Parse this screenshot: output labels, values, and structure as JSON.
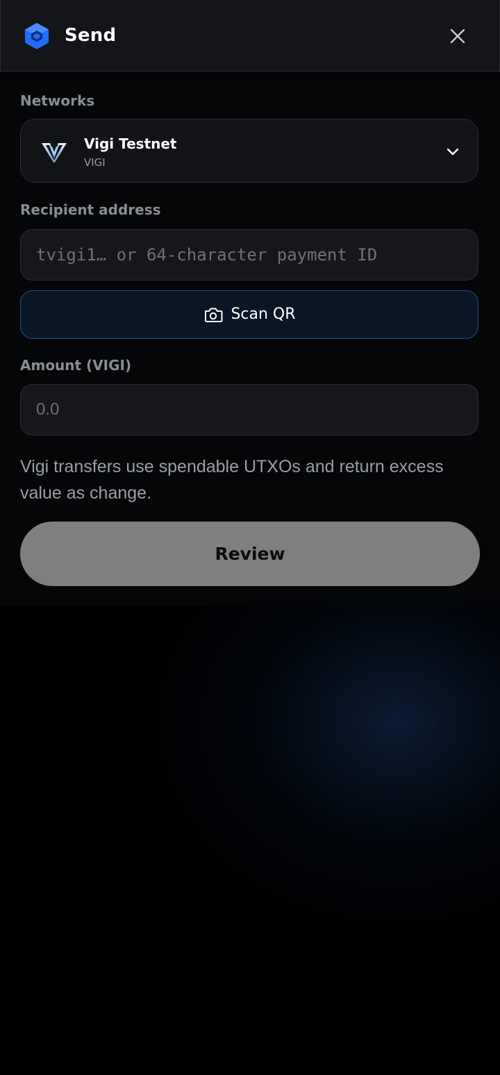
{
  "header": {
    "title": "Send",
    "logo_icon": "wallet-logo-icon",
    "close_icon": "close-icon"
  },
  "networks": {
    "label": "Networks",
    "selected_name": "Vigi Testnet",
    "selected_symbol": "VIGI",
    "network_icon": "vigi-logo-icon",
    "dropdown_icon": "chevron-down-icon"
  },
  "recipient": {
    "label": "Recipient address",
    "value": "",
    "placeholder": "tvigi1… or 64-character payment ID"
  },
  "scan": {
    "label": "Scan QR",
    "icon": "camera-icon"
  },
  "amount": {
    "label": "Amount (VIGI)",
    "value": "",
    "placeholder": "0.0"
  },
  "helper_text": "Vigi transfers use spendable UTXOs and return excess value as change.",
  "review": {
    "label": "Review"
  },
  "colors": {
    "background": "#000000",
    "header_bg": "#141518",
    "field_bg": "#16171b",
    "accent_border": "#24508c",
    "review_button_bg": "#7f7f7f",
    "label_color": "#8a8d93",
    "logo_blue": "#1f6fff"
  }
}
